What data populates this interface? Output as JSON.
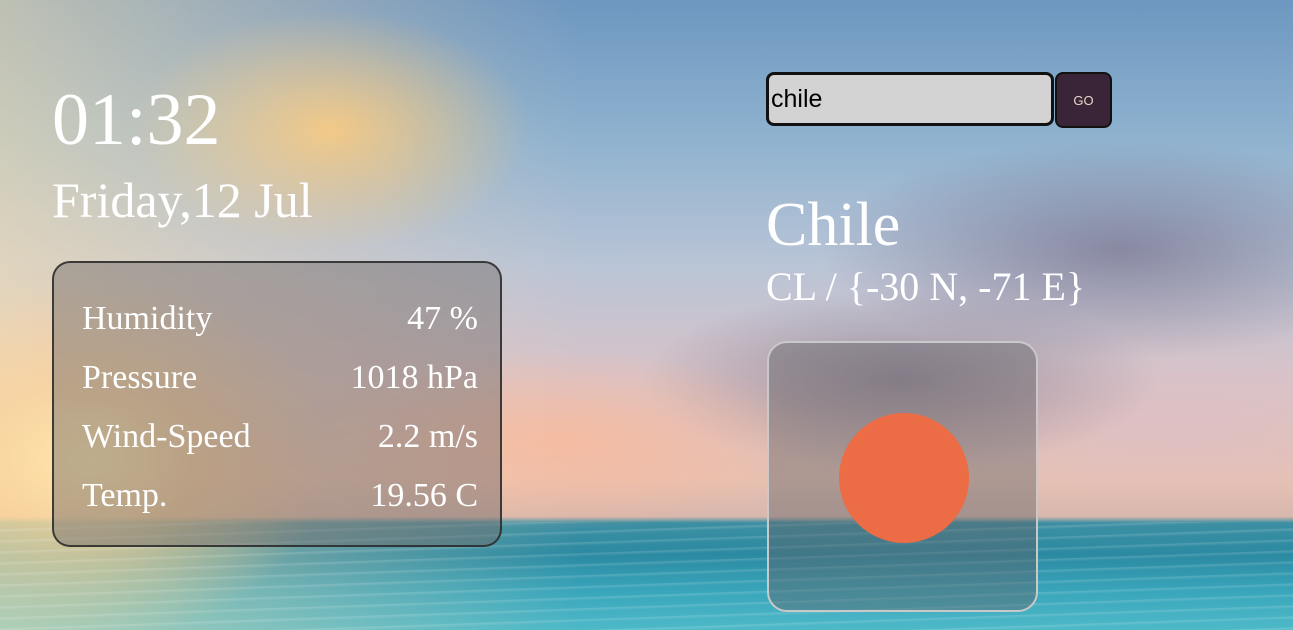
{
  "clock": {
    "time": "01:32",
    "date": "Friday,12 Jul"
  },
  "search": {
    "value": "chile",
    "go_label": "GO"
  },
  "location": {
    "name": "Chile",
    "coords": "CL / {-30 N, -71 E}"
  },
  "stats": [
    {
      "label": "Humidity",
      "value": "47 %"
    },
    {
      "label": "Pressure",
      "value": "1018 hPa"
    },
    {
      "label": "Wind-Speed",
      "value": "2.2 m/s"
    },
    {
      "label": "Temp.",
      "value": "19.56 C"
    }
  ],
  "weather_icon": {
    "name": "sun-icon",
    "color": "#ec6c45"
  },
  "colors": {
    "go_button_bg": "#3a2538",
    "input_bg": "#d3d3d3"
  }
}
